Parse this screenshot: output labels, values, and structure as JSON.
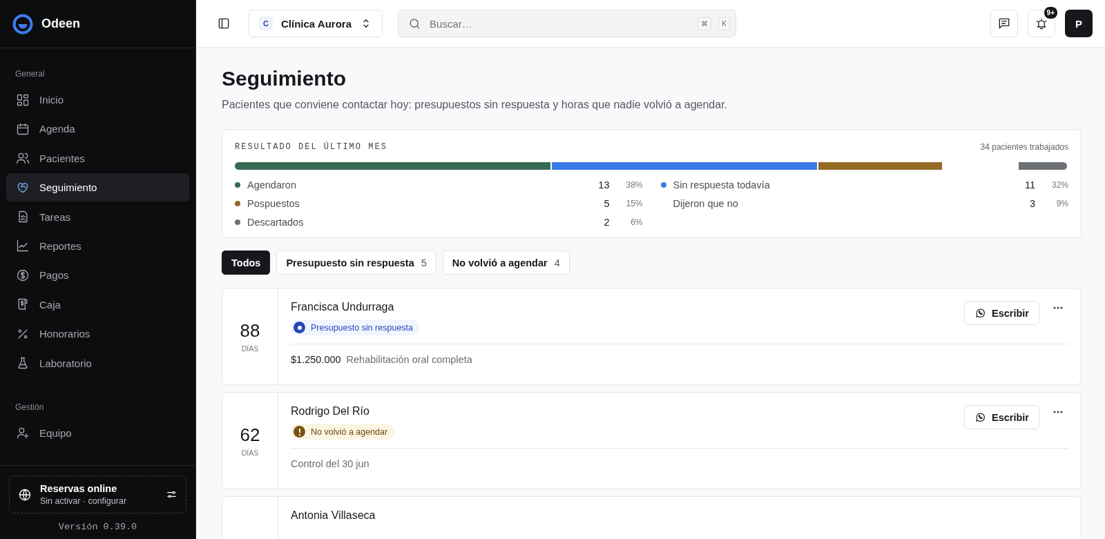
{
  "sidebar": {
    "brand": "Odeen",
    "sections": [
      {
        "title": "General",
        "items": [
          {
            "label": "Inicio",
            "selected": false
          },
          {
            "label": "Agenda",
            "selected": false
          },
          {
            "label": "Pacientes",
            "selected": false
          },
          {
            "label": "Seguimiento",
            "selected": true
          },
          {
            "label": "Tareas",
            "selected": false
          },
          {
            "label": "Reportes",
            "selected": false
          },
          {
            "label": "Pagos",
            "selected": false
          },
          {
            "label": "Caja",
            "selected": false
          },
          {
            "label": "Honorarios",
            "selected": false
          },
          {
            "label": "Laboratorio",
            "selected": false
          }
        ]
      },
      {
        "title": "Gestión",
        "items": [
          {
            "label": "Equipo",
            "selected": false
          }
        ]
      }
    ],
    "booking": {
      "title": "Reservas online",
      "subtitle": "Sin activar · configurar"
    },
    "version": "Versión 0.39.0"
  },
  "topbar": {
    "clinic": {
      "initial": "C",
      "name": "Clínica Aurora"
    },
    "search": {
      "placeholder": "Buscar…",
      "shortcut": [
        "⌘",
        "K"
      ]
    },
    "notifications_badge": "9+",
    "avatar": "P"
  },
  "page": {
    "title": "Seguimiento",
    "subtitle": "Pacientes que conviene contactar hoy: presupuestos sin respuesta y horas que nadie volvió a agendar."
  },
  "summary": {
    "title": "RESULTADO DEL ÚLTIMO MES",
    "total": "34 pacientes trabajados",
    "outcomes": [
      {
        "label": "Agendaron",
        "count": "13",
        "percent": "38%",
        "color": "#356b52"
      },
      {
        "label": "Sin respuesta todavía",
        "count": "11",
        "percent": "32%",
        "color": "#3b7be8"
      },
      {
        "label": "Pospuestos",
        "count": "5",
        "percent": "15%",
        "color": "#946a24"
      },
      {
        "label": "Dijeron que no",
        "count": "3",
        "percent": "9%"
      },
      {
        "label": "Descartados",
        "count": "2",
        "percent": "6%",
        "color": "#6c6f75"
      }
    ]
  },
  "filters": [
    {
      "label": "Todos",
      "selected": true
    },
    {
      "label": "Presupuesto sin respuesta",
      "count": "5",
      "selected": false
    },
    {
      "label": "No volvió a agendar",
      "count": "4",
      "selected": false
    }
  ],
  "followups": [
    {
      "days": "88",
      "unit": "DÍAS",
      "name": "Francisca Undurraga",
      "status": {
        "kind": "budget",
        "label": "Presupuesto sin respuesta"
      },
      "amount": "$1.250.000",
      "detail": "Rehabilitación oral completa",
      "action": "Escribir"
    },
    {
      "days": "62",
      "unit": "DÍAS",
      "name": "Rodrigo Del Río",
      "status": {
        "kind": "no-return",
        "label": "No volvió a agendar"
      },
      "detail": "Control del 30 jun",
      "action": "Escribir"
    },
    {
      "name": "Antonia Villaseca"
    }
  ]
}
